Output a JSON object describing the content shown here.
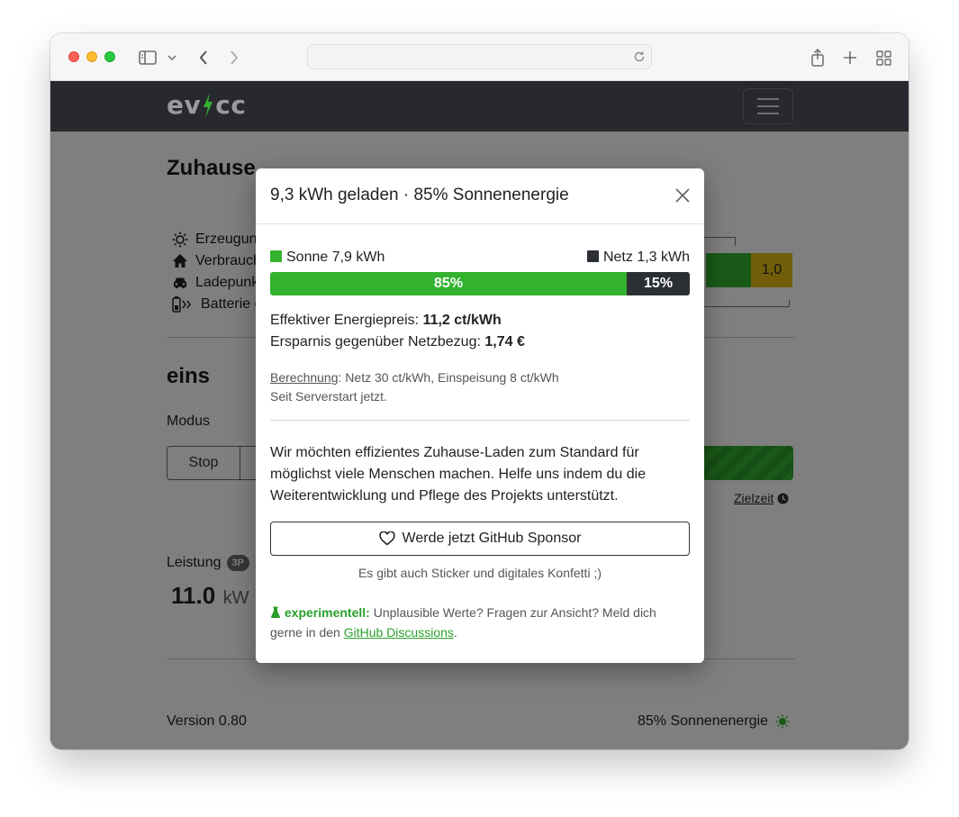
{
  "app": {
    "logo_left": "ev",
    "logo_right": "cc"
  },
  "background": {
    "site_title": "Zuhause",
    "legend": [
      {
        "label": "Erzeugung",
        "icon": "sun-icon"
      },
      {
        "label": "Verbrauch",
        "icon": "home-icon"
      },
      {
        "label": "Ladepunkt",
        "icon": "car-icon"
      },
      {
        "label": "Batterie e",
        "icon": "battery-icon"
      }
    ],
    "energy_value": "1,0",
    "loadpoint_title": "eins",
    "mode_label": "Modus",
    "mode_stop": "Stop",
    "target_time": "Zielzeit",
    "power_label": "Leistung",
    "phases_badge": "3P",
    "power_value": "11.0",
    "power_unit": "kW",
    "version": "Version 0.80",
    "footer_solar": "85% Sonnenenergie"
  },
  "modal": {
    "title": "9,3 kWh geladen · 85% Sonnenenergie",
    "solar_label": "Sonne 7,9 kWh",
    "grid_label": "Netz 1,3 kWh",
    "solar_percent": "85%",
    "grid_percent": "15%",
    "solar_share": 0.85,
    "price_label": "Effektiver Energiepreis: ",
    "price_value": "11,2 ct/kWh",
    "savings_label": "Ersparnis gegenüber Netzbezug: ",
    "savings_value": "1,74 €",
    "calc_link": "Berechnung",
    "calc_text": ": Netz 30 ct/kWh, Einspeisung 8 ct/kWh",
    "since": "Seit Serverstart jetzt.",
    "pitch_lines": [
      "Wir möchten effizientes Zuhause-Laden zum Standard für",
      "möglichst viele Menschen machen. Helfe uns indem du die",
      "Weiterentwicklung und Pflege des Projekts unterstützt."
    ],
    "sponsor_button": "Werde jetzt GitHub Sponsor",
    "sticker_note": "Es gibt auch Sticker und digitales Konfetti ;)",
    "experimental_label": "experimentell:",
    "experimental_text": " Unplausible Werte? Fragen zur Ansicht? Meld dich",
    "experimental_text2": "gerne in den ",
    "discussions_link": "GitHub Discussions",
    "experimental_end": "."
  },
  "colors": {
    "solar": "#33b22f",
    "grid": "#2c3034",
    "accent_yellow": "#e2bd14"
  }
}
